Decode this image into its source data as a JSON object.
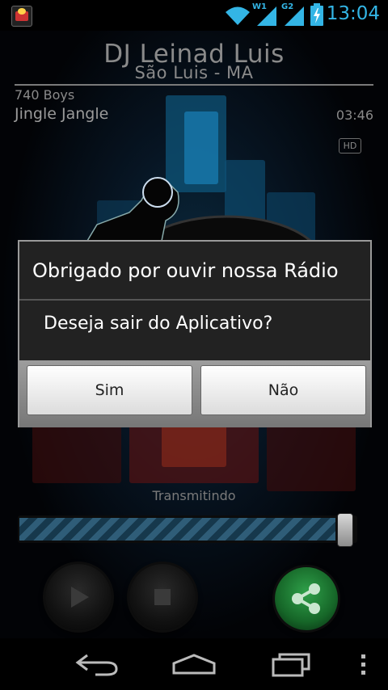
{
  "status_bar": {
    "time": "13:04",
    "network_labels": [
      "W1",
      "G2"
    ],
    "icons": [
      "app-notification-icon",
      "wifi-icon",
      "signal-icon",
      "battery-charging-icon"
    ],
    "accent_color": "#33b5e5"
  },
  "player": {
    "station_name": "DJ Leinad Luis",
    "location": "São Luis - MA",
    "artist": "740 Boys",
    "song": "Jingle Jangle",
    "duration": "03:46",
    "hd_badge": "HD",
    "status": "Transmitindo",
    "progress_fraction": 0.94,
    "controls": [
      "play-icon",
      "stop-icon",
      "share-icon"
    ]
  },
  "dialog": {
    "title": "Obrigado por ouvir nossa Rádio",
    "message": "Deseja sair do Aplicativo?",
    "yes_label": "Sim",
    "no_label": "Não"
  },
  "navbar": {
    "icons": [
      "back-icon",
      "home-icon",
      "recent-apps-icon",
      "overflow-menu-icon"
    ]
  }
}
